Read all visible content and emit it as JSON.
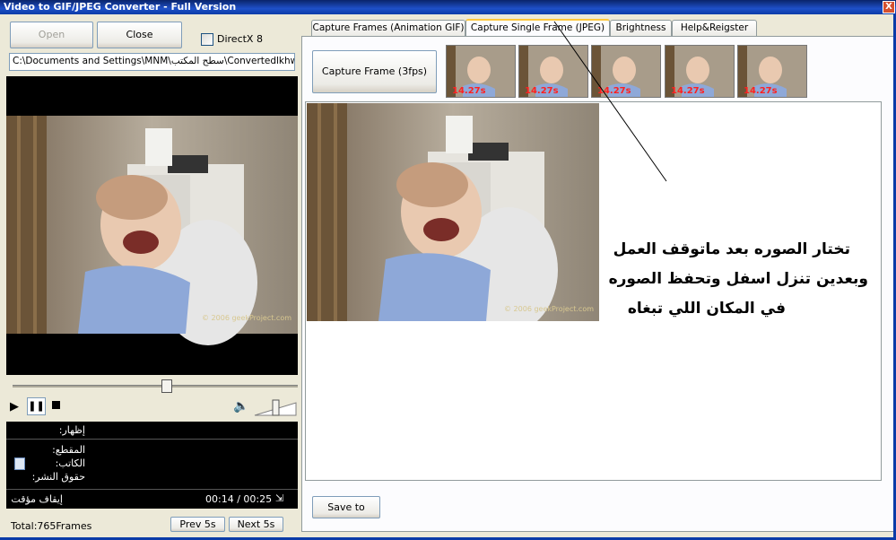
{
  "window": {
    "title": "Video to GIF/JPEG Converter - Full Version",
    "close": "X"
  },
  "toolbar": {
    "open_label": "Open",
    "close_label": "Close",
    "directx_label": "DirectX 8"
  },
  "path_field": {
    "value": "C:\\Documents and Settings\\MNM\\سطح المكتب\\Convertedlkhwa"
  },
  "player": {
    "info_show": "إظهار:",
    "info_clip": "المقطع:",
    "info_author": "الكاتب:",
    "info_copyright": "حقوق النشر:",
    "status": "إيقاف مؤقت",
    "time": "00:14 / 00:25",
    "total_frames": "Total:765Frames",
    "prev_label": "Prev 5s",
    "next_label": "Next 5s",
    "watermark": "© 2006 geekProject.com"
  },
  "tabs": [
    {
      "label": "Capture Frames (Animation GIF)"
    },
    {
      "label": "Capture Single Frame (JPEG)"
    },
    {
      "label": "Brightness"
    },
    {
      "label": "Help&Reigster"
    }
  ],
  "capture": {
    "button_label": "Capture Frame (3fps)",
    "thumb_times": [
      "14.27s",
      "14.27s",
      "14.27s",
      "14.27s",
      "14.27s"
    ],
    "save_label": "Save to"
  },
  "annotation": {
    "line1": "تختار الصوره بعد ماتوقف العمل",
    "line2": "وبعدين تنزل اسفل وتحفظ الصوره",
    "line3": "في المكان اللي تبغاه"
  }
}
